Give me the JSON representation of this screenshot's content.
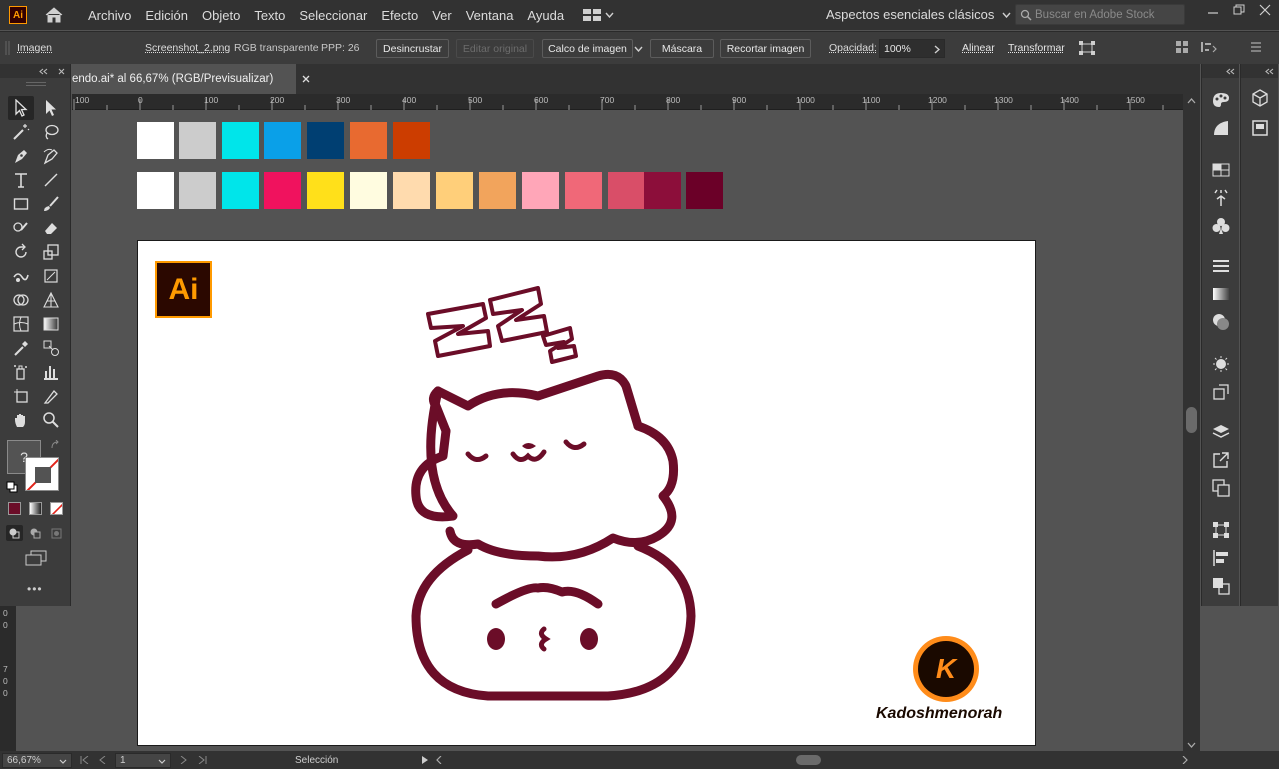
{
  "app": {
    "logo_text": "Ai",
    "menu": [
      "Archivo",
      "Edición",
      "Objeto",
      "Texto",
      "Seleccionar",
      "Efecto",
      "Ver",
      "Ventana",
      "Ayuda"
    ],
    "workspace": "Aspectos esenciales clásicos",
    "search_placeholder": "Buscar en Adobe Stock"
  },
  "control_bar": {
    "object_type": "Imagen",
    "file_name": "Screenshot_2.png",
    "color_mode": "RGB transparente",
    "ppp": "PPP: 26",
    "embed_button": "Desincrustar",
    "edit_original_button": "Editar original",
    "trace_button": "Calco de imagen",
    "mask_button": "Máscara",
    "crop_button": "Recortar imagen",
    "opacity_label": "Opacidad:",
    "opacity_value": "100%",
    "align_link": "Alinear",
    "transform_link": "Transformar"
  },
  "document": {
    "tab_title": "endo.ai* al 66,67% (RGB/Previsualizar)"
  },
  "ruler": {
    "h_labels": [
      "100",
      "0",
      "100",
      "200",
      "300",
      "400",
      "500",
      "600",
      "700",
      "800",
      "900",
      "1000",
      "1100",
      "1200",
      "1300",
      "1400",
      "1500"
    ],
    "v_labels": [
      "0",
      "0",
      "7",
      "0",
      "0"
    ]
  },
  "swatches": {
    "row1": [
      "#ffffff",
      "#cccccc",
      "#00e5ea",
      "#0aa0e8",
      "#003f72",
      "#e86a30",
      "#cc3d00"
    ],
    "row2": [
      "#ffffff",
      "#cccccc",
      "#00e5ea",
      "#f0125e",
      "#ffe01a",
      "#fffce0",
      "#ffdbae",
      "#ffcf7a",
      "#f2a45c",
      "#ffa6b8",
      "#f06878",
      "#d94e68",
      "#8c0e3a",
      "#6b0028"
    ]
  },
  "artwork": {
    "ai_badge_text": "Ai",
    "watermark_letter": "K",
    "watermark_text": "Kadoshmenorah",
    "stroke_color": "#6b0d28",
    "ai_badge_bg": "#2b0800",
    "ai_badge_fg": "#ff9a00"
  },
  "status_bar": {
    "zoom": "66,67%",
    "artboard_number": "1",
    "tool_name": "Selección"
  }
}
